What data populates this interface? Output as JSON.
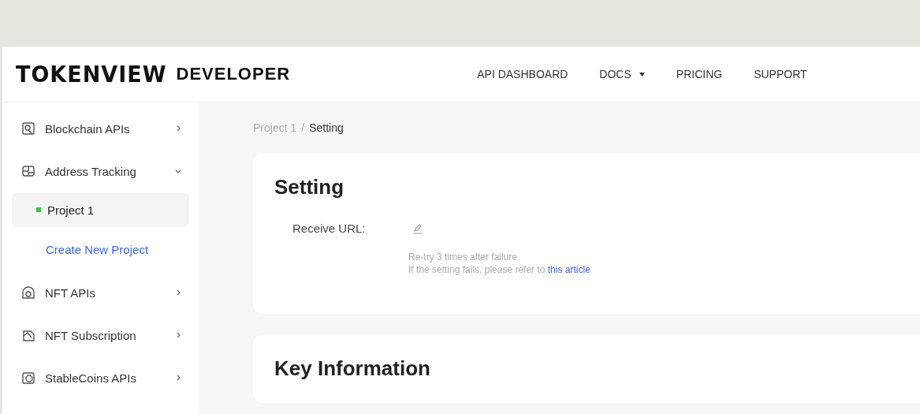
{
  "header": {
    "logo": "TOKENVIEW",
    "logo_suffix": "DEVELOPER",
    "nav": [
      {
        "label": "API DASHBOARD",
        "dropdown": false
      },
      {
        "label": "DOCS",
        "dropdown": true
      },
      {
        "label": "PRICING",
        "dropdown": false
      },
      {
        "label": "SUPPORT",
        "dropdown": false
      }
    ]
  },
  "sidebar": {
    "items": [
      {
        "label": "Blockchain APIs",
        "expanded": false
      },
      {
        "label": "Address Tracking",
        "expanded": true,
        "children": [
          {
            "kind": "project",
            "label": "Project 1",
            "selected": true,
            "color": "#3cbf4a"
          },
          {
            "kind": "link",
            "label": "Create New Project",
            "selected": false
          }
        ]
      },
      {
        "label": "NFT APIs",
        "expanded": false
      },
      {
        "label": "NFT Subscription",
        "expanded": false
      },
      {
        "label": "StableCoins APIs",
        "expanded": false
      }
    ]
  },
  "breadcrumb": {
    "separator": "/",
    "items": [
      "Project 1",
      "Setting"
    ]
  },
  "setting_card": {
    "title": "Setting",
    "field_label": "Receive URL:",
    "hint": "Re-try 3 times after failure",
    "hint_2": "If the setting fails, please refer to",
    "hint_link": "this article"
  },
  "key_card": {
    "title": "Key Information"
  }
}
